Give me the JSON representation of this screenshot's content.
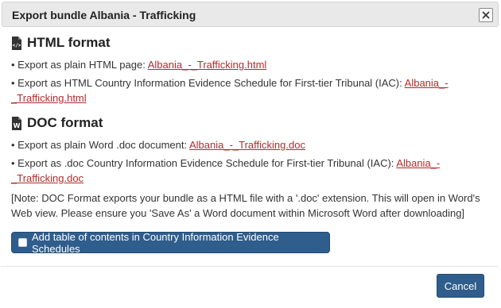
{
  "dialog": {
    "title": "Export bundle Albania - Trafficking",
    "close_icon": "close-icon"
  },
  "html_section": {
    "heading": "HTML format",
    "icon": "html-file-icon",
    "items": [
      {
        "text": "• Export as plain HTML page: ",
        "link": "Albania_-_Trafficking.html"
      },
      {
        "text": "• Export as HTML Country Information Evidence Schedule for First-tier Tribunal (IAC): ",
        "link_part1": "Albania_-",
        "link_part2": "_Trafficking.html"
      }
    ]
  },
  "doc_section": {
    "heading": "DOC format",
    "icon": "word-file-icon",
    "items": [
      {
        "text": "• Export as plain Word .doc document: ",
        "link": "Albania_-_Trafficking.doc"
      },
      {
        "text": "• Export as .doc Country Information Evidence Schedule for First-tier Tribunal (IAC): ",
        "link_part1": "Albania_-",
        "link_part2": "_Trafficking.doc"
      }
    ],
    "note_line1": "[Note: DOC Format exports your bundle as a HTML file with a '.doc' extension. This will open in Word's",
    "note_line2": "Web view. Please ensure you 'Save As' a Word document within Microsoft Word after downloading]"
  },
  "toc_button": {
    "label": "Add table of contents in Country Information Evidence Schedules",
    "checked": false
  },
  "footer": {
    "cancel_label": "Cancel"
  },
  "colors": {
    "link": "#b42b2b",
    "primary_button": "#2f5d8c",
    "title_bar": "#e9e9e9"
  }
}
